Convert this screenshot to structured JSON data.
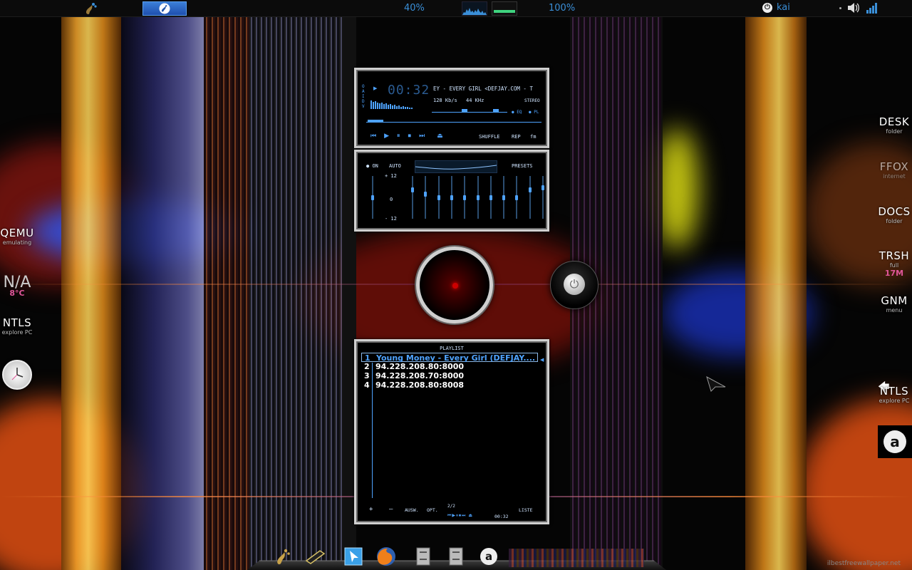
{
  "top_panel": {
    "cpu_percent": "40%",
    "memory_percent": "100%",
    "username": "kai",
    "memory_level": 1.0
  },
  "left_launchers": [
    {
      "name": "QEMU",
      "sub": "emulating"
    },
    {
      "name": "N/A",
      "sub": "8°C"
    },
    {
      "name": "NTLS",
      "sub": "explore PC"
    }
  ],
  "right_launchers": [
    {
      "name": "DESK",
      "sub": "folder"
    },
    {
      "name": "FFOX",
      "sub": "internet"
    },
    {
      "name": "DOCS",
      "sub": "folder"
    },
    {
      "name": "TRSH",
      "sub": "full",
      "extra": "17M"
    },
    {
      "name": "GNM",
      "sub": "menu"
    },
    {
      "name": "NTLS",
      "sub": "explore PC"
    }
  ],
  "player": {
    "time": "00:32",
    "title_scroll": "EY - EVERY GIRL <DEFJAY.COM - T",
    "bitrate": "128 Kb/s",
    "samplerate": "44 KHz",
    "stereo": "STEREO",
    "eq_indicator": "EQ",
    "pl_indicator": "PL",
    "shuffle": "SHUFFLE",
    "repeat": "REP",
    "fm": "fm",
    "side_letters": [
      "O",
      "A",
      "I",
      "D",
      "V"
    ]
  },
  "equalizer": {
    "on_label": "ON",
    "auto_label": "AUTO",
    "presets_label": "PRESETS",
    "plus_label": "+ 12",
    "zero_label": "0",
    "minus_label": "- 12",
    "preamp": 0.5,
    "bands": [
      0.3,
      0.42,
      0.5,
      0.5,
      0.5,
      0.5,
      0.5,
      0.5,
      0.5,
      0.3,
      0.25
    ]
  },
  "playlist": {
    "title": "PLAYLIST",
    "items": [
      {
        "num": "1",
        "text": "Young Money - Every Girl (DEFJAY...."
      },
      {
        "num": "2",
        "text": "94.228.208.80:8000"
      },
      {
        "num": "3",
        "text": "94.228.208.70:8000"
      },
      {
        "num": "4",
        "text": "94.228.208.80:8008"
      }
    ],
    "footer_add": "+",
    "footer_rem": "–",
    "footer_sel": "AUSW.",
    "footer_opt": "OPT.",
    "footer_page": "2/2",
    "footer_time": "00:32",
    "footer_list": "LISTE"
  },
  "watermark": "ilbestfreewallpaper.net"
}
